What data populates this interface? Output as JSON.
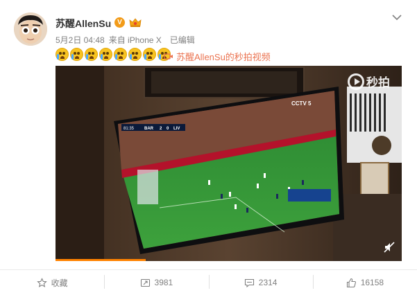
{
  "post": {
    "username": "苏醒AllenSu",
    "verified_badge": "V",
    "date": "5月2日 04:48",
    "source": "来自 iPhone X",
    "edited": "已编辑",
    "emoji_count": 8,
    "emoji_name": "crying-face",
    "video_link": "苏醒AllenSu的秒拍视频"
  },
  "video": {
    "logo_text": "秒拍",
    "scoreboard": {
      "team_home": "BAR",
      "score_home": "2",
      "score_away": "0",
      "team_away": "LIV",
      "clock": "81:35"
    },
    "tv_channel": "CCTV 5",
    "progress": 0.26
  },
  "actions": {
    "favorite": "收藏",
    "repost": "3981",
    "comment": "2314",
    "like": "16158"
  },
  "colors": {
    "link": "#eb7350",
    "badge": "#f29b19",
    "progress": "#ff8200"
  }
}
